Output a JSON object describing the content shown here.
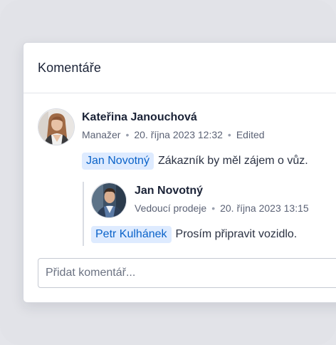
{
  "panel": {
    "title": "Komentáře"
  },
  "comments": [
    {
      "author": "Kateřina Janouchová",
      "role": "Manažer",
      "timestamp": "20. října 2023 12:32",
      "status": "Edited",
      "mention": "Jan Novotný",
      "text": "Zákazník by měl zájem o vůz.",
      "avatar_icon": "woman-avatar-icon"
    }
  ],
  "replies": [
    {
      "author": "Jan Novotný",
      "role": "Vedoucí prodeje",
      "timestamp": "20. října 2023 13:15",
      "mention": "Petr Kulhánek",
      "text": "Prosím připravit vozidlo.",
      "avatar_icon": "man-avatar-icon"
    }
  ],
  "composer": {
    "placeholder": "Přidat komentář..."
  },
  "colors": {
    "mention_bg": "#deebff",
    "mention_text": "#0b63c9",
    "background": "#e4e5ea"
  }
}
